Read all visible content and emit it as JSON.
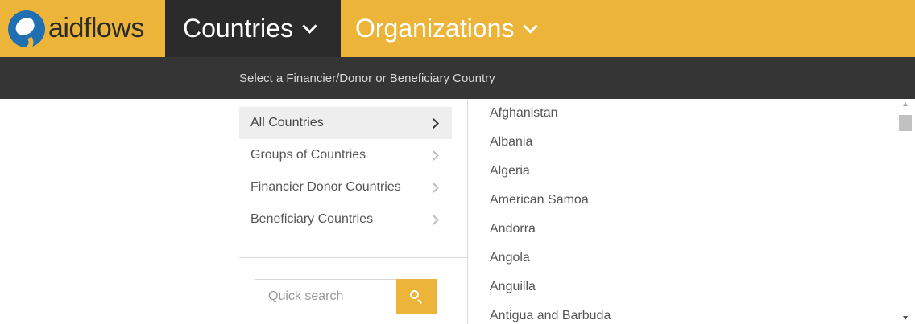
{
  "brand": {
    "name": "aidflows"
  },
  "nav": {
    "countries_label": "Countries",
    "organizations_label": "Organizations"
  },
  "subbar": {
    "text": "Select a Financier/Donor or Beneficiary Country"
  },
  "menu": {
    "items": [
      {
        "label": "All Countries",
        "active": true
      },
      {
        "label": "Groups of Countries",
        "active": false
      },
      {
        "label": "Financier Donor Countries",
        "active": false
      },
      {
        "label": "Beneficiary Countries",
        "active": false
      }
    ]
  },
  "search": {
    "placeholder": "Quick search",
    "value": ""
  },
  "countries": [
    "Afghanistan",
    "Albania",
    "Algeria",
    "American Samoa",
    "Andorra",
    "Angola",
    "Anguilla",
    "Antigua and Barbuda"
  ],
  "colors": {
    "accent": "#ecb53a",
    "nav_dark": "#2b2b2b",
    "subbar": "#353535",
    "globe": "#1f6fb2"
  },
  "icons": {
    "logo": "aidflows-globe-logo",
    "dropdown": "chevron-down-icon",
    "menu_arrow": "chevron-right-icon",
    "search": "search-icon"
  }
}
